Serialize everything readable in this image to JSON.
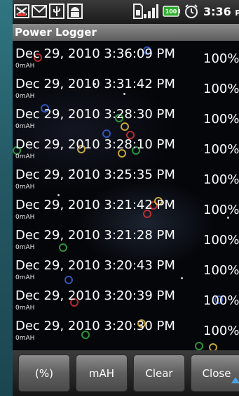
{
  "status_bar": {
    "time": "3:36",
    "ampm": "PM",
    "battery_level": "100",
    "icons": [
      "missed-call-icon",
      "gmail-icon",
      "usb-icon",
      "android-debug-icon",
      "sim-card-icon",
      "signal-icon",
      "battery-icon",
      "alarm-icon"
    ]
  },
  "app": {
    "title": "Power Logger"
  },
  "log_entries": [
    {
      "date": "Dec 29, 2010 3:36:09 PM",
      "mah": "0mAH",
      "percent": "100%"
    },
    {
      "date": "Dec 29, 2010 3:31:42 PM",
      "mah": "0mAH",
      "percent": "100%"
    },
    {
      "date": "Dec 29, 2010 3:28:30 PM",
      "mah": "0mAH",
      "percent": "100%"
    },
    {
      "date": "Dec 29, 2010 3:28:10 PM",
      "mah": "0mAH",
      "percent": "100%"
    },
    {
      "date": "Dec 29, 2010 3:25:35 PM",
      "mah": "0mAH",
      "percent": "100%"
    },
    {
      "date": "Dec 29, 2010 3:21:42 PM",
      "mah": "0mAH",
      "percent": "100%"
    },
    {
      "date": "Dec 29, 2010 3:21:28 PM",
      "mah": "0mAH",
      "percent": "100%"
    },
    {
      "date": "Dec 29, 2010 3:20:43 PM",
      "mah": "0mAH",
      "percent": "100%"
    },
    {
      "date": "Dec 29, 2010 3:20:39 PM",
      "mah": "0mAH",
      "percent": "100%"
    },
    {
      "date": "Dec 29, 2010 3:20:30 PM",
      "mah": "0mAH",
      "percent": "100%"
    }
  ],
  "buttons": {
    "percent_label": "(%)",
    "mah_label": "mAH",
    "clear_label": "Clear",
    "close_label": "Close"
  },
  "colors": {
    "frame": "#2a6470",
    "status_bar": "#1a1a1a",
    "title_bar": "#6e6e6e",
    "button": "#6a6a6a",
    "accent_arrow": "#4aa3e0"
  }
}
